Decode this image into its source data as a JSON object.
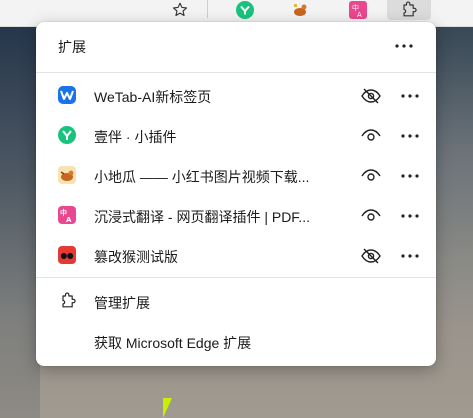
{
  "panel": {
    "title": "扩展",
    "extensions": [
      {
        "name": "WeTab-AI新标签页",
        "icon": "wetab-icon",
        "visibility": "hidden"
      },
      {
        "name": "壹伴 · 小插件",
        "icon": "yiban-icon",
        "visibility": "shown"
      },
      {
        "name": "小地瓜 —— 小红书图片视频下载...",
        "icon": "xiaodigua-icon",
        "visibility": "shown"
      },
      {
        "name": "沉浸式翻译 - 网页翻译插件 | PDF...",
        "icon": "immersive-translate-icon",
        "visibility": "shown"
      },
      {
        "name": "篡改猴测试版",
        "icon": "tampermonkey-icon",
        "visibility": "hidden"
      }
    ],
    "manage_label": "管理扩展",
    "get_label": "获取 Microsoft Edge 扩展"
  },
  "colors": {
    "wetab": "#1a73e8",
    "yiban": "#19c37d",
    "immersive": "#e9478f",
    "tampermonkey": "#e53935",
    "text": "#1b1b1b"
  }
}
